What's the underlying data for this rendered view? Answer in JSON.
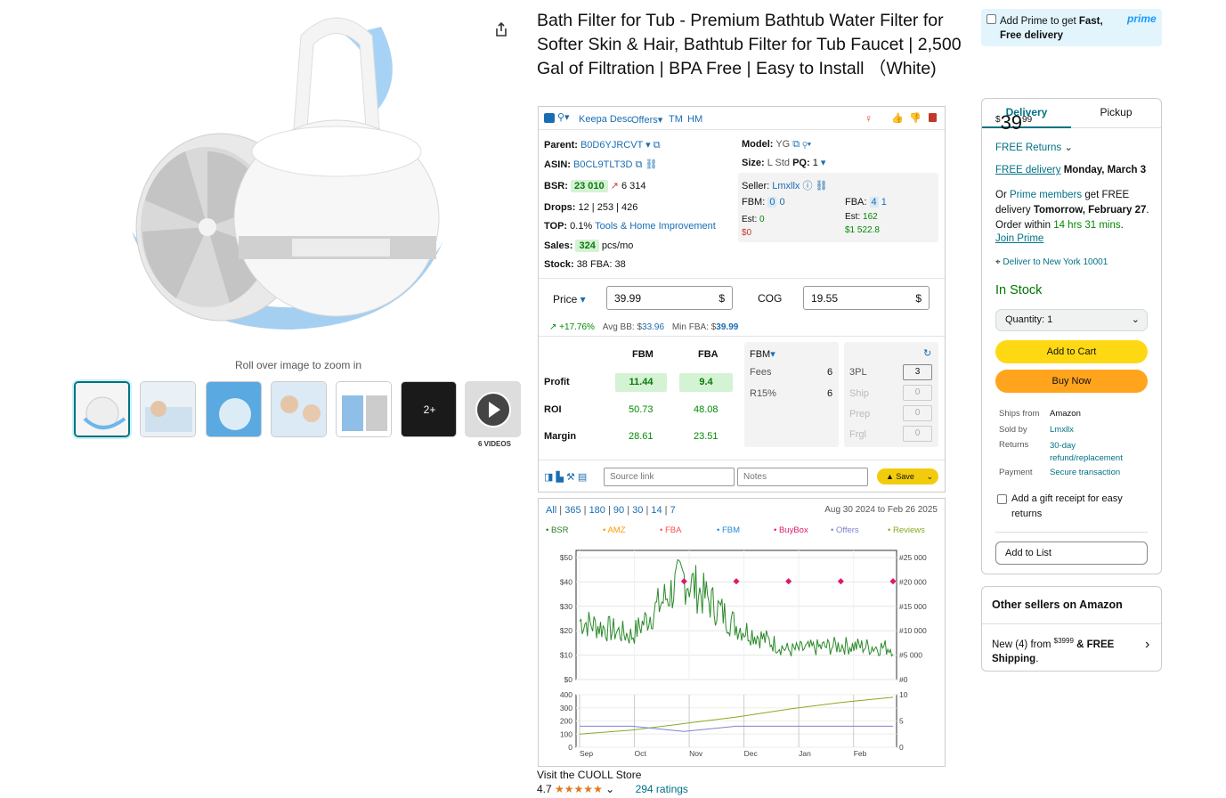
{
  "gallery": {
    "zoom_hint": "Roll over image to zoom in",
    "more_images_label": "2+",
    "videos_label": "6 VIDEOS"
  },
  "title": "Bath Filter for Tub - Premium Bathtub Water Filter for Softer Skin & Hair, Bathtub Filter for Tub Faucet | 2,500 Gal of Filtration | BPA Free | Easy to Install （White)",
  "keepa": {
    "toolbar": {
      "desc": "Keepa Desc",
      "offers": "Offers",
      "tm": "TM",
      "hm": "HM"
    },
    "parent_label": "Parent:",
    "parent": "B0D6YJRCVT",
    "asin_label": "ASIN:",
    "asin": "B0CL9TLT3D",
    "bsr_label": "BSR:",
    "bsr": "23 010",
    "bsr_change": "6 314",
    "drops_label": "Drops:",
    "drops": "12 | 253 | 426",
    "top_label": "TOP:",
    "top_pct": "0.1%",
    "top_cat": "Tools & Home Improvement",
    "sales_label": "Sales:",
    "sales": "324",
    "sales_unit": "pcs/mo",
    "stock_label": "Stock:",
    "stock": "38 FBA: 38",
    "model_label": "Model:",
    "model": "YG",
    "size_label": "Size:",
    "size": "L Std",
    "pq_label": "PQ:",
    "pq": "1",
    "seller_label": "Seller:",
    "seller": "Lmxllx",
    "fbm_label": "FBM:",
    "fbm_a": "0",
    "fbm_b": "0",
    "fba_label": "FBA:",
    "fba_a": "4",
    "fba_b": "1",
    "est_label": "Est:",
    "fbm_est": "0",
    "fbm_est_money": "$0",
    "fba_est": "162",
    "fba_est_money": "$1 522.8",
    "price_label": "Price",
    "price_value": "39.99",
    "currency": "$",
    "cog_label": "COG",
    "cog_value": "19.55",
    "change": "+17.76%",
    "avg_bb_label": "Avg BB: $",
    "avg_bb": "33.96",
    "min_fba_label": "Min FBA: $",
    "min_fba": "39.99",
    "col_fbm": "FBM",
    "col_fba": "FBA",
    "profit_label": "Profit",
    "profit_fbm": "11.44",
    "profit_fba": "9.4",
    "roi_label": "ROI",
    "roi_fbm": "50.73",
    "roi_fba": "48.08",
    "margin_label": "Margin",
    "margin_fbm": "28.61",
    "margin_fba": "23.51",
    "fees_mode": "FBM",
    "fees_label": "Fees",
    "fees_value": "6",
    "r15_label": "R15%",
    "r15_value": "6",
    "tpl_label": "3PL",
    "tpl_value": "3",
    "ship_label": "Ship",
    "ship_value": "0",
    "prep_label": "Prep",
    "prep_value": "0",
    "frgl_label": "Frgl",
    "frgl_value": "0",
    "source_placeholder": "Source link",
    "notes_placeholder": "Notes",
    "save_label": "Save"
  },
  "chart": {
    "ranges": [
      "All",
      "365",
      "180",
      "90",
      "30",
      "14",
      "7"
    ],
    "date_range": "Aug 30 2024 to Feb 26 2025",
    "legend": [
      {
        "name": "BSR",
        "color": "#2a7d2a"
      },
      {
        "name": "AMZ",
        "color": "#ff9900"
      },
      {
        "name": "FBA",
        "color": "#ff4d4d"
      },
      {
        "name": "FBM",
        "color": "#1f8bd6"
      },
      {
        "name": "BuyBox",
        "color": "#e0186c"
      },
      {
        "name": "Offers",
        "color": "#8080d0"
      },
      {
        "name": "Reviews",
        "color": "#88aa22"
      }
    ],
    "y_left": [
      "$50",
      "$40",
      "$30",
      "$20",
      "$10",
      "$0"
    ],
    "y_right": [
      "#25 000",
      "#20 000",
      "#15 000",
      "#10 000",
      "#5 000",
      "#0"
    ],
    "y2_left": [
      "400",
      "300",
      "200",
      "100",
      "0"
    ],
    "y2_right": [
      "10",
      "5",
      "0"
    ],
    "months": [
      "Sep",
      "Oct",
      "Nov",
      "Dec",
      "Jan",
      "Feb"
    ]
  },
  "chart_data": {
    "type": "line",
    "x": [
      "2024-09-01",
      "2024-10-01",
      "2024-11-01",
      "2024-12-01",
      "2025-01-01",
      "2025-02-01",
      "2025-02-26"
    ],
    "ylim": [
      0,
      25000
    ],
    "y2lim": [
      0,
      400
    ],
    "y_price_lim": [
      0,
      50
    ],
    "series": [
      {
        "name": "BSR",
        "values": [
          12000,
          9000,
          21000,
          11000,
          6000,
          7000,
          6500
        ]
      },
      {
        "name": "BuyBox",
        "values": [
          null,
          null,
          40,
          40,
          40,
          40,
          40
        ]
      },
      {
        "name": "Reviews",
        "values": [
          100,
          130,
          180,
          230,
          290,
          340,
          380
        ]
      },
      {
        "name": "Offers",
        "values": [
          4,
          4,
          3,
          4,
          4,
          4,
          4
        ]
      }
    ]
  },
  "store_link": "Visit the CUOLL Store",
  "rating": "4.7",
  "ratings_count": "294 ratings",
  "buybox": {
    "prime_line1": "Add Prime to get ",
    "prime_bold": "Fast, Free delivery",
    "prime_logo": "prime",
    "tab_delivery": "Delivery",
    "tab_pickup": "Pickup",
    "price_sym": "$",
    "price_whole": "39",
    "price_frac": "99",
    "free_returns": "FREE Returns",
    "free_delivery": "FREE delivery",
    "delivery_date": "Monday, March 3",
    "or_text": "Or ",
    "prime_members": "Prime members",
    "get_free": " get FREE delivery ",
    "fast_date": "Tomorrow, February 27",
    "order_within": ". Order within ",
    "countdown": "14 hrs 31 mins",
    "join_prime": "Join Prime",
    "deliver_to": "Deliver to New York 10001",
    "stock": "In Stock",
    "quantity": "Quantity:  1",
    "add_to_cart": "Add to Cart",
    "buy_now": "Buy Now",
    "ships_from_label": "Ships from",
    "ships_from": "Amazon",
    "sold_by_label": "Sold by",
    "sold_by": "Lmxllx",
    "returns_label": "Returns",
    "returns": "30-day refund/replacement",
    "payment_label": "Payment",
    "payment": "Secure transaction",
    "gift_receipt": "Add a gift receipt for easy returns",
    "add_to_list": "Add to List"
  },
  "other_sellers": {
    "title": "Other sellers on Amazon",
    "new_count": "New (4) from ",
    "price": "$39",
    "price_frac": "99",
    "free_ship": "& FREE Shipping",
    "dot": "."
  }
}
